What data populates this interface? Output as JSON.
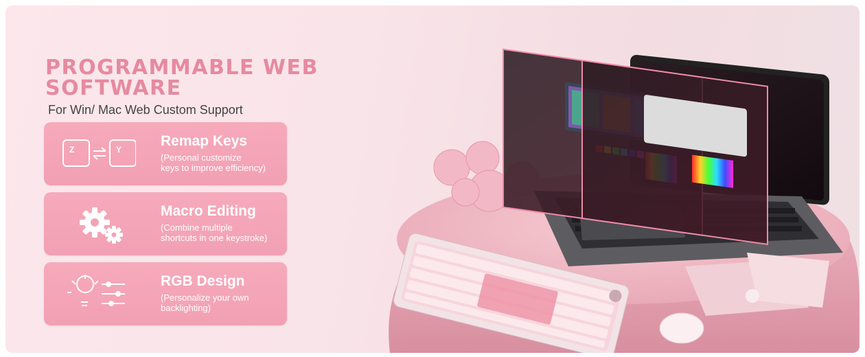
{
  "headline": {
    "line1": "PROGRAMMABLE WEB",
    "line2": "SOFTWARE"
  },
  "subhead": "For Win/ Mac Web Custom Support",
  "features": [
    {
      "icon": "remap-keys-icon",
      "key_from": "Z",
      "key_to": "Y",
      "title": "Remap Keys",
      "desc_line1": "(Personal customize",
      "desc_line2": "keys to improve efficiency)"
    },
    {
      "icon": "gears-icon",
      "title": "Macro Editing",
      "desc_line1": "(Combine multiple",
      "desc_line2": "shortcuts in one keystroke)"
    },
    {
      "icon": "lightbulb-sliders-icon",
      "title": "RGB Design",
      "desc_line1": "(Personalize your own",
      "desc_line2": "backlighting)"
    }
  ],
  "colors": {
    "accent": "#e68aa0",
    "card": "#f4a6b8",
    "background": "#fbe7ec"
  }
}
